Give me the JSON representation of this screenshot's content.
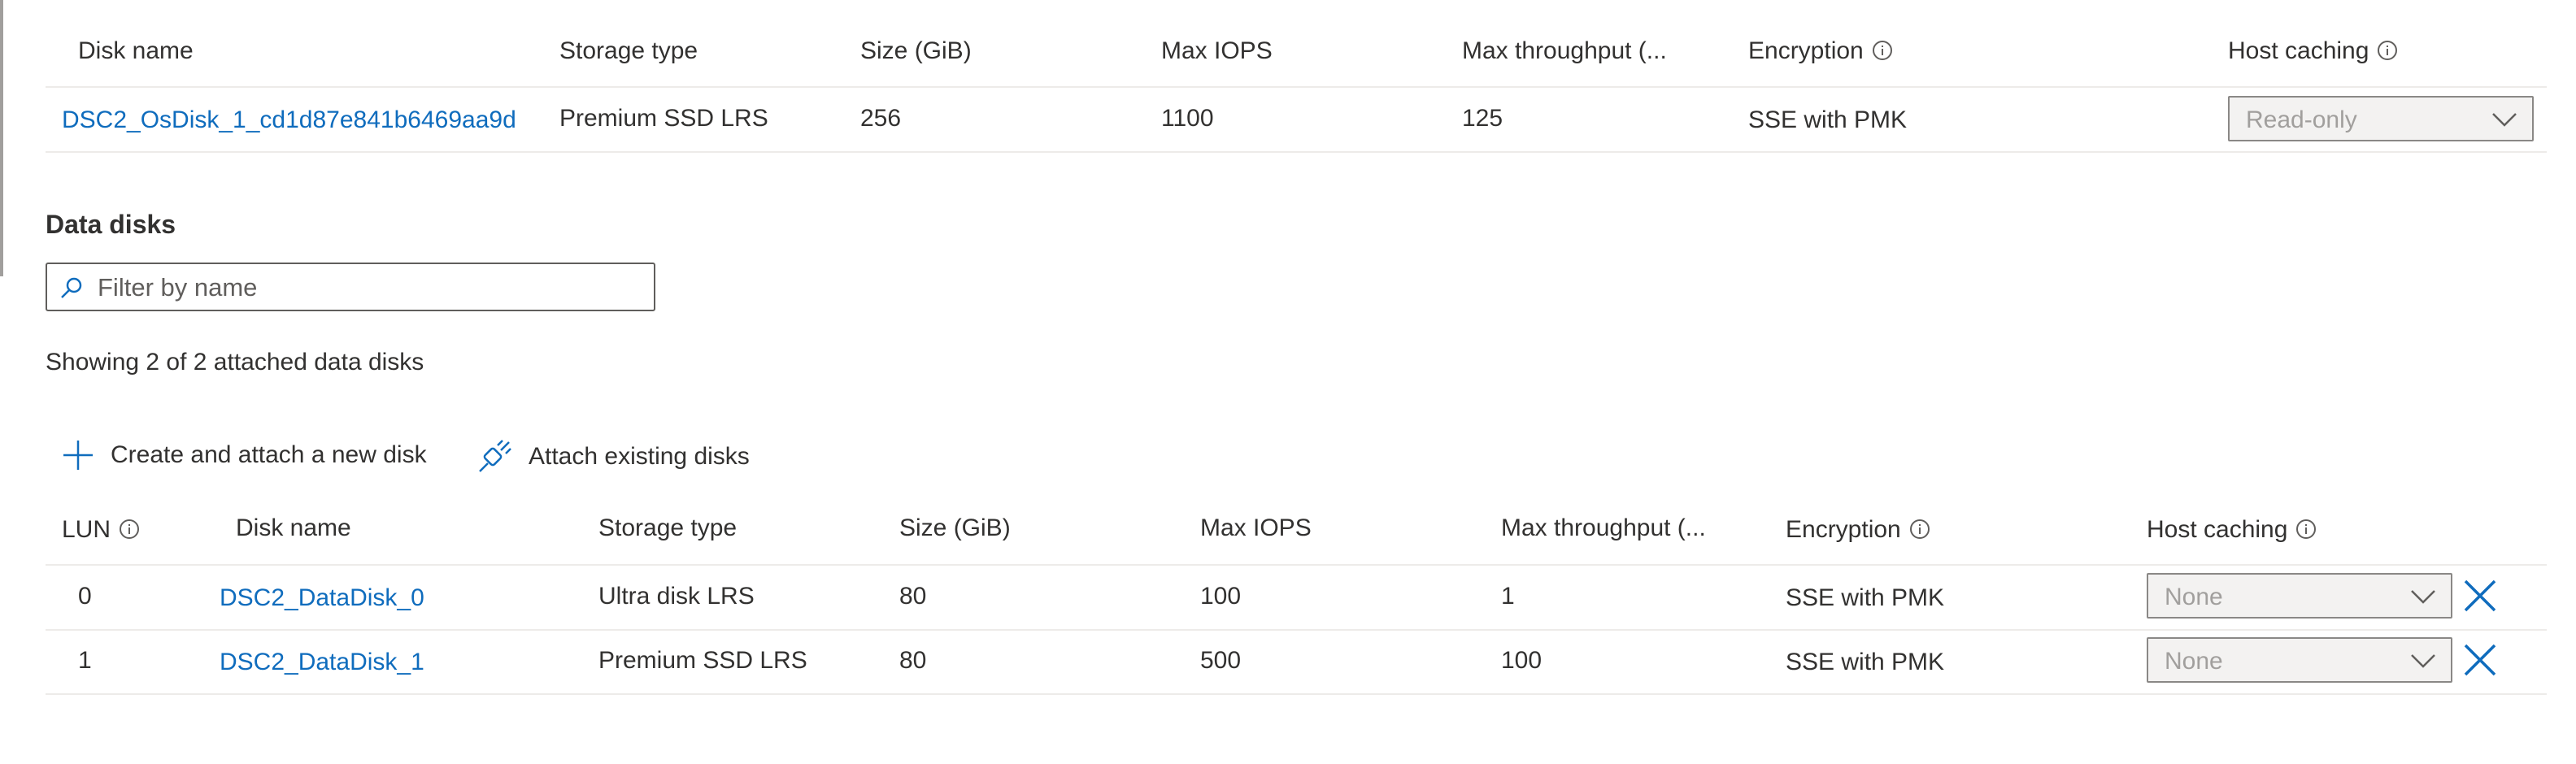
{
  "os_disk": {
    "columns": [
      "Disk name",
      "Storage type",
      "Size (GiB)",
      "Max IOPS",
      "Max throughput (...",
      "Encryption",
      "Host caching"
    ],
    "row": {
      "name": "DSC2_OsDisk_1_cd1d87e841b6469aa9d",
      "storage_type": "Premium SSD LRS",
      "size": "256",
      "max_iops": "1100",
      "max_throughput": "125",
      "encryption": "SSE with PMK",
      "host_caching": "Read-only"
    }
  },
  "data_disks": {
    "title": "Data disks",
    "filter_placeholder": "Filter by name",
    "showing_text": "Showing 2 of 2 attached data disks",
    "toolbar": {
      "create_label": "Create and attach a new disk",
      "attach_label": "Attach existing disks"
    },
    "columns": [
      "LUN",
      "Disk name",
      "Storage type",
      "Size (GiB)",
      "Max IOPS",
      "Max throughput (...",
      "Encryption",
      "Host caching"
    ],
    "rows": [
      {
        "lun": "0",
        "name": "DSC2_DataDisk_0",
        "storage_type": "Ultra disk LRS",
        "size": "80",
        "max_iops": "100",
        "max_throughput": "1",
        "encryption": "SSE with PMK",
        "host_caching": "None"
      },
      {
        "lun": "1",
        "name": "DSC2_DataDisk_1",
        "storage_type": "Premium SSD LRS",
        "size": "80",
        "max_iops": "500",
        "max_throughput": "100",
        "encryption": "SSE with PMK",
        "host_caching": "None"
      }
    ]
  },
  "icons": {
    "info": "info-icon",
    "search": "search-icon",
    "add": "add-icon",
    "attach": "attach-icon",
    "chevron": "chevron-down-icon",
    "remove": "close-icon"
  },
  "colors": {
    "link": "#0f6cbd",
    "text": "#323130",
    "disabled_text": "#a19f9d",
    "row_divider": "#edebe9"
  }
}
